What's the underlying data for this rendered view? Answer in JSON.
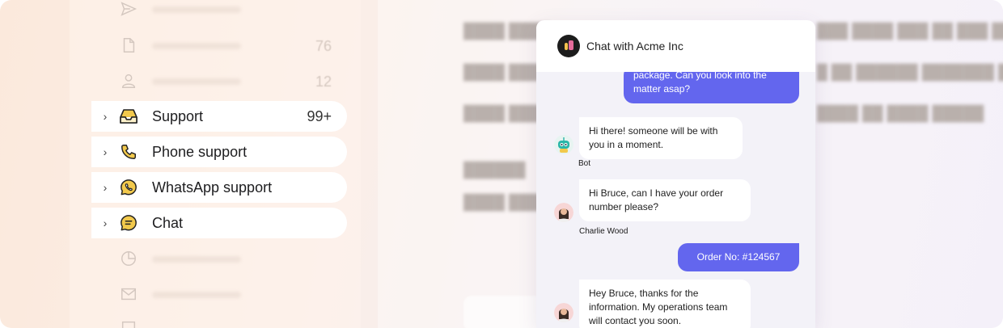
{
  "nav": {
    "ghost_counts": [
      "76",
      "12"
    ],
    "items": [
      {
        "label": "Support",
        "count": "99+",
        "icon": "inbox-icon"
      },
      {
        "label": "Phone support",
        "count": "",
        "icon": "phone-icon"
      },
      {
        "label": "WhatsApp support",
        "count": "",
        "icon": "whatsapp-icon"
      },
      {
        "label": "Chat",
        "count": "",
        "icon": "chat-bubble-icon"
      }
    ]
  },
  "chat": {
    "title": "Chat with Acme Inc",
    "messages": [
      {
        "from": "user",
        "text": "package. Can you look into the matter asap?"
      },
      {
        "from": "Bot",
        "text": "Hi there! someone will be with you in a moment."
      },
      {
        "from": "Charlie Wood",
        "text": "Hi Bruce, can I have your order number please?"
      },
      {
        "from": "user",
        "text": "Order No: #124567"
      },
      {
        "from": "agent",
        "text": "Hey Bruce, thanks for the information. My operations team will contact you soon."
      }
    ]
  },
  "colors": {
    "accent": "#6366ee",
    "icon_yellow": "#f2c94c",
    "icon_outline": "#222222",
    "header_bg": "#ffffff",
    "chat_bg": "#f3f2f8"
  }
}
